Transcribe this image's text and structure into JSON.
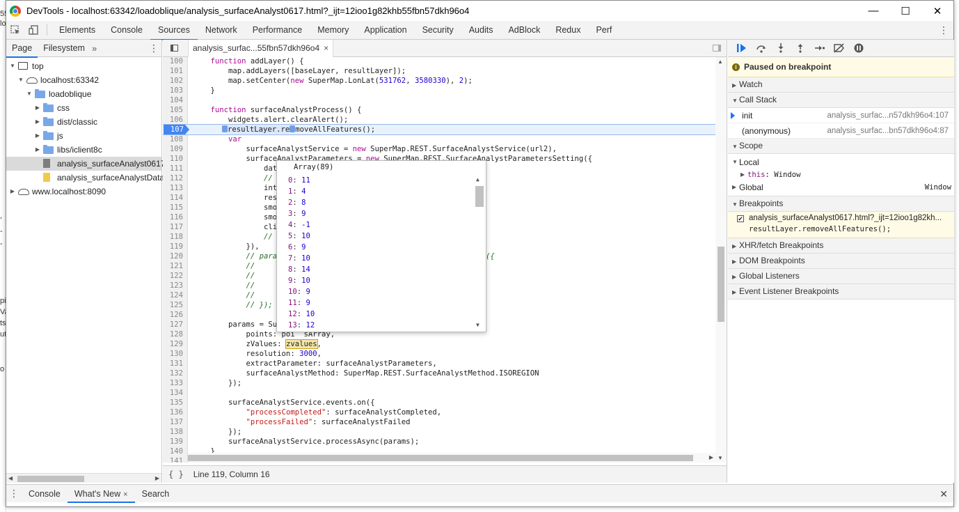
{
  "window": {
    "title": "DevTools - localhost:63342/loadoblique/analysis_surfaceAnalyst0617.html?_ijt=12ioo1g82khb55fbn57dkh96o4",
    "minimize": "—",
    "maximize": "☐",
    "close": "✕"
  },
  "toolbar": {
    "tabs": [
      "Elements",
      "Console",
      "Sources",
      "Network",
      "Performance",
      "Memory",
      "Application",
      "Security",
      "Audits",
      "AdBlock",
      "Redux",
      "Perf"
    ],
    "active_tab": "Sources",
    "menu": "⋮"
  },
  "navigator": {
    "tabs": [
      "Page",
      "Filesystem"
    ],
    "more": "»",
    "menu": "⋮",
    "tree": [
      {
        "label": "top",
        "depth": 0,
        "icon": "frame",
        "expanded": true
      },
      {
        "label": "localhost:63342",
        "depth": 1,
        "icon": "cloud",
        "expanded": true
      },
      {
        "label": "loadoblique",
        "depth": 2,
        "icon": "folder",
        "expanded": true
      },
      {
        "label": "css",
        "depth": 3,
        "icon": "folder",
        "expanded": false
      },
      {
        "label": "dist/classic",
        "depth": 3,
        "icon": "folder",
        "expanded": false
      },
      {
        "label": "js",
        "depth": 3,
        "icon": "folder",
        "expanded": false
      },
      {
        "label": "libs/iclient8c",
        "depth": 3,
        "icon": "folder",
        "expanded": false
      },
      {
        "label": "analysis_surfaceAnalyst0617.",
        "depth": 3,
        "icon": "file-gray",
        "selected": true
      },
      {
        "label": "analysis_surfaceAnalystData.j",
        "depth": 3,
        "icon": "file-yellow"
      },
      {
        "label": "www.localhost:8090",
        "depth": 0,
        "icon": "cloud",
        "expanded": false
      }
    ]
  },
  "editor": {
    "file_tab": "analysis_surfac...55fbn57dkh96o4",
    "file_close": "×",
    "status_icon": "{ }",
    "cursor_position": "Line 119, Column 16",
    "lines": [
      {
        "n": "100",
        "code": "    function addLayer() {"
      },
      {
        "n": "101",
        "code": "        map.addLayers([baseLayer, resultLayer]);"
      },
      {
        "n": "102",
        "code": "        map.setCenter(new SuperMap.LonLat(531762, 3580330), 2);"
      },
      {
        "n": "103",
        "code": "    }"
      },
      {
        "n": "104",
        "code": ""
      },
      {
        "n": "105",
        "code": "    function surfaceAnalystProcess() {"
      },
      {
        "n": "106",
        "code": "        widgets.alert.clearAlert();"
      },
      {
        "n": "107",
        "code": "resultLayer.re moveAllFeatures();",
        "breakpoint": true
      },
      {
        "n": "108",
        "code": "        var"
      },
      {
        "n": "109",
        "code": "            surfaceAnalystService = new SuperMap.REST.SurfaceAnalystService(url2),"
      },
      {
        "n": "110",
        "code": "            surfaceAnalystParameters = new SuperMap.REST.SurfaceAnalystParametersSetting({"
      },
      {
        "n": "111",
        "code": "                datu"
      },
      {
        "n": "112",
        "code": "                // i"
      },
      {
        "n": "113",
        "code": "                inte"
      },
      {
        "n": "114",
        "code": "                resa"
      },
      {
        "n": "115",
        "code": "                smoo"
      },
      {
        "n": "116",
        "code": "                smoo"
      },
      {
        "n": "117",
        "code": "                clip"
      },
      {
        "n": "118",
        "code": "                // c"
      },
      {
        "n": "119",
        "code": "            }),"
      },
      {
        "n": "120",
        "code": "            // param                                     arameters({"
      },
      {
        "n": "121",
        "code": "            //     e"
      },
      {
        "n": "122",
        "code": "            //     d"
      },
      {
        "n": "123",
        "code": "            //     r"
      },
      {
        "n": "124",
        "code": "            //     z"
      },
      {
        "n": "125",
        "code": "            // });"
      },
      {
        "n": "126",
        "code": ""
      },
      {
        "n": "127",
        "code": "        params = Sup"
      },
      {
        "n": "128",
        "code": "            points: poi  sArray,"
      },
      {
        "n": "129",
        "code": "            zValues: zvalues,"
      },
      {
        "n": "130",
        "code": "            resolution: 3000,"
      },
      {
        "n": "131",
        "code": "            extractParameter: surfaceAnalystParameters,"
      },
      {
        "n": "132",
        "code": "            surfaceAnalystMethod: SuperMap.REST.SurfaceAnalystMethod.ISOREGION"
      },
      {
        "n": "133",
        "code": "        });"
      },
      {
        "n": "134",
        "code": ""
      },
      {
        "n": "135",
        "code": "        surfaceAnalystService.events.on({"
      },
      {
        "n": "136",
        "code": "            \"processCompleted\": surfaceAnalystCompleted,"
      },
      {
        "n": "137",
        "code": "            \"processFailed\": surfaceAnalystFailed"
      },
      {
        "n": "138",
        "code": "        });"
      },
      {
        "n": "139",
        "code": "        surfaceAnalystService.processAsync(params);"
      },
      {
        "n": "140",
        "code": "    }"
      },
      {
        "n": "141",
        "code": ""
      }
    ]
  },
  "popover": {
    "title": "Array(89)",
    "items": [
      {
        "k": "0",
        "v": "11"
      },
      {
        "k": "1",
        "v": "4"
      },
      {
        "k": "2",
        "v": "8"
      },
      {
        "k": "3",
        "v": "9"
      },
      {
        "k": "4",
        "v": "-1"
      },
      {
        "k": "5",
        "v": "10"
      },
      {
        "k": "6",
        "v": "9"
      },
      {
        "k": "7",
        "v": "10"
      },
      {
        "k": "8",
        "v": "14"
      },
      {
        "k": "9",
        "v": "10"
      },
      {
        "k": "10",
        "v": "9"
      },
      {
        "k": "11",
        "v": "9"
      },
      {
        "k": "12",
        "v": "10"
      },
      {
        "k": "13",
        "v": "12"
      }
    ]
  },
  "debugger": {
    "paused_text": "Paused on breakpoint",
    "sections": {
      "watch": "Watch",
      "call_stack": "Call Stack",
      "scope": "Scope",
      "breakpoints": "Breakpoints",
      "xhr": "XHR/fetch Breakpoints",
      "dom": "DOM Breakpoints",
      "global_listeners": "Global Listeners",
      "event_listeners": "Event Listener Breakpoints"
    },
    "call_stack": [
      {
        "fn": "init",
        "loc": "analysis_surfac...n57dkh96o4:107",
        "current": true
      },
      {
        "fn": "(anonymous)",
        "loc": "analysis_surfac...bn57dkh96o4:87",
        "current": false
      }
    ],
    "scope": {
      "local": "Local",
      "this_key": "this",
      "this_value": "Window",
      "global": "Global",
      "global_value": "Window"
    },
    "breakpoint": {
      "file": "analysis_surfaceAnalyst0617.html?_ijt=12ioo1g82kh...",
      "code": "resultLayer.removeAllFeatures();"
    }
  },
  "drawer": {
    "menu": "⋮",
    "tabs": [
      "Console",
      "What's New",
      "Search"
    ],
    "active_tab": "What's New",
    "tab_close": "×",
    "close": "✕"
  }
}
